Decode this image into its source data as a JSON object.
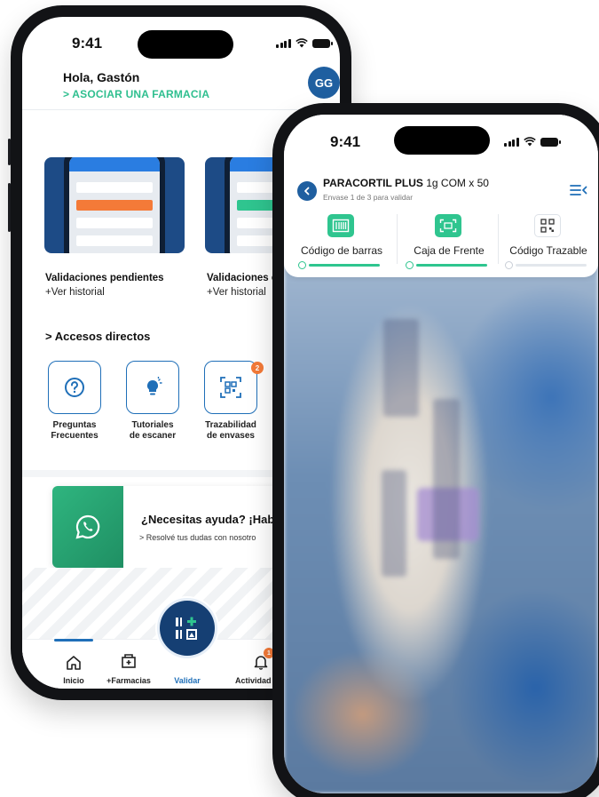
{
  "back_phone": {
    "status": {
      "time": "9:41"
    },
    "header": {
      "greeting": "Hola, Gastón",
      "link": "> ASOCIAR UNA FARMACIA",
      "avatar_initials": "GG"
    },
    "cards": [
      {
        "title": "Validaciones pendientes",
        "link": "+Ver historial"
      },
      {
        "title": "Validaciones e",
        "link": "+Ver historial"
      }
    ],
    "quick_access": {
      "title": "> Accesos directos",
      "items": [
        {
          "label_1": "Preguntas",
          "label_2": "Frecuentes",
          "icon": "question-icon"
        },
        {
          "label_1": "Tutoriales",
          "label_2": "de escaner",
          "icon": "lightbulb-icon"
        },
        {
          "label_1": "Trazabilidad",
          "label_2": "de envases",
          "icon": "qr-scan-icon",
          "badge": "2"
        }
      ]
    },
    "help": {
      "title": "¿Necesitas ayuda? ¡Habl",
      "subtitle": "> Resolvé tus dudas con nosotro",
      "icon": "whatsapp-icon"
    },
    "nav": {
      "items": [
        {
          "label": "Inicio",
          "icon": "home-icon"
        },
        {
          "label": "+Farmacias",
          "icon": "pharmacy-icon"
        },
        {
          "label": "Validar",
          "icon": "validate-icon"
        },
        {
          "label": "Actividad",
          "icon": "bell-icon",
          "badge": "1"
        }
      ]
    }
  },
  "front_phone": {
    "status": {
      "time": "9:41"
    },
    "product": {
      "name_bold": "PARACORTIL PLUS",
      "name_rest": " 1g COM x 50",
      "subtitle": "Envase 1 de 3 para validar"
    },
    "steps": [
      {
        "label": "Código de barras",
        "state": "done",
        "icon": "barcode-icon"
      },
      {
        "label": "Caja de Frente",
        "state": "done",
        "icon": "box-scan-icon"
      },
      {
        "label": "Código Trazable",
        "state": "pending",
        "icon": "qr-code-icon"
      }
    ]
  },
  "colors": {
    "primary": "#1f5fa0",
    "accent_green": "#2fc58f",
    "badge_orange": "#f47a38"
  }
}
